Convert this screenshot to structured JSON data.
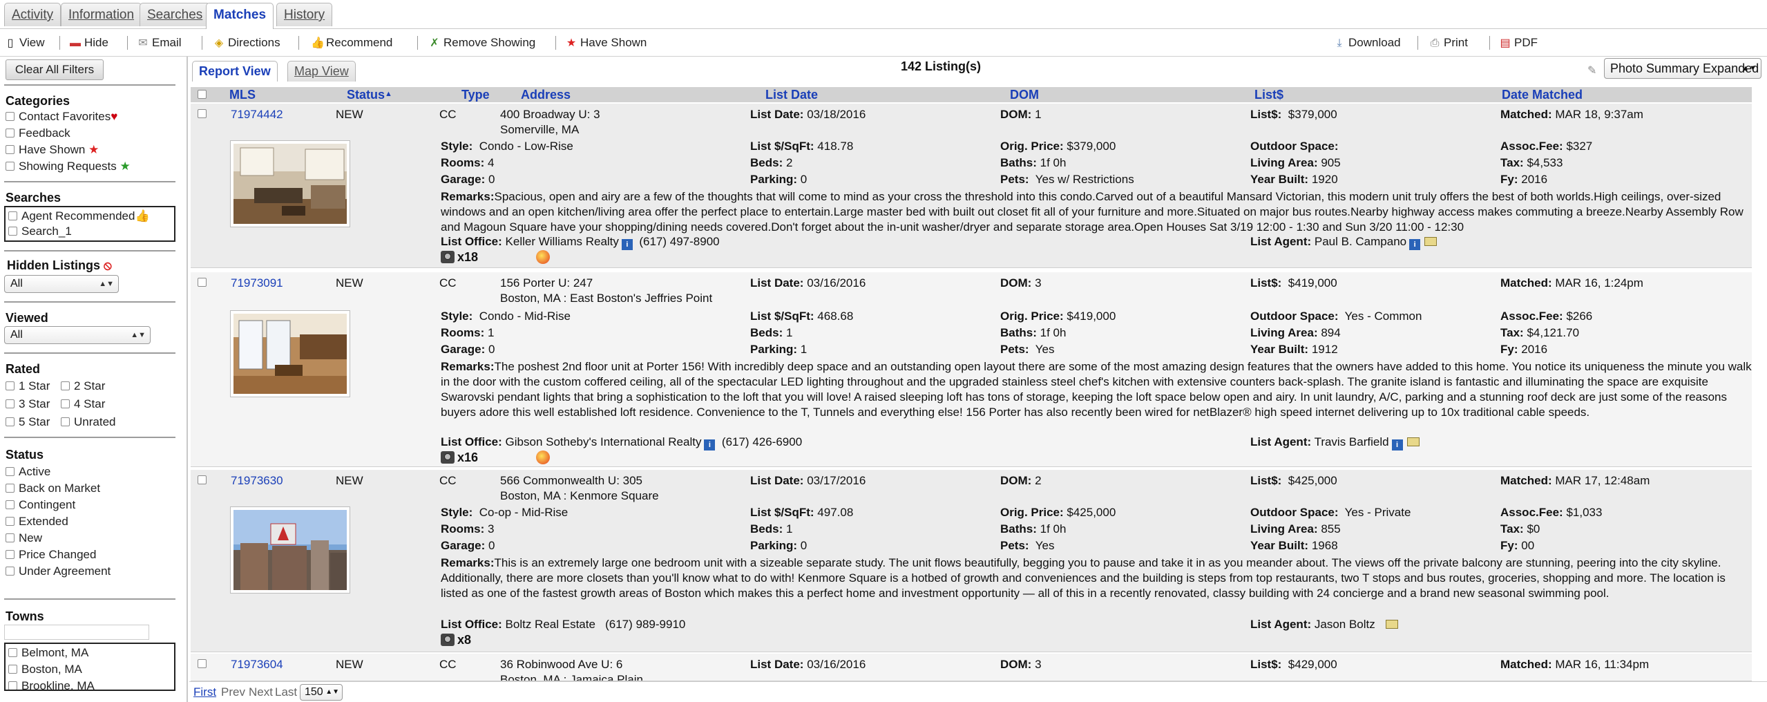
{
  "tabs": [
    "Activity",
    "Information",
    "Searches",
    "Matches",
    "History"
  ],
  "toolbar": {
    "view": "View",
    "hide": "Hide",
    "email": "Email",
    "directions": "Directions",
    "recommend": "Recommend",
    "remove_showing": "Remove Showing",
    "have_shown": "Have Shown",
    "download": "Download",
    "print": "Print",
    "pdf": "PDF"
  },
  "sidebar": {
    "clear_filters": "Clear All Filters",
    "categories_title": "Categories",
    "categories": [
      "Contact Favorites",
      "Feedback",
      "Have Shown",
      "Showing Requests"
    ],
    "searches_title": "Searches",
    "searches": [
      "Agent Recommended",
      "Search_1"
    ],
    "hidden_title": "Hidden Listings",
    "hidden_value": "All",
    "viewed_title": "Viewed",
    "viewed_value": "All",
    "rated_title": "Rated",
    "rated": [
      "1 Star",
      "2 Star",
      "3 Star",
      "4 Star",
      "5 Star",
      "Unrated"
    ],
    "status_title": "Status",
    "status": [
      "Active",
      "Back on Market",
      "Contingent",
      "Extended",
      "New",
      "Price Changed",
      "Under Agreement"
    ],
    "towns_title": "Towns",
    "towns_search": "",
    "towns": [
      "Belmont, MA",
      "Boston, MA",
      "Brookline, MA"
    ]
  },
  "main": {
    "view_tabs": [
      "Report View",
      "Map View"
    ],
    "count": "142 Listing(s)",
    "view_select": "Photo Summary Expanded",
    "columns": {
      "mls": "MLS",
      "status": "Status",
      "type": "Type",
      "address": "Address",
      "list_date": "List Date",
      "dom": "DOM",
      "list_price": "List$",
      "date_matched": "Date Matched"
    }
  },
  "labels": {
    "list_date": "List Date:",
    "dom": "DOM:",
    "list_price": "List$:",
    "matched": "Matched:",
    "style": "Style:",
    "list_sqft": "List $/SqFt:",
    "orig_price": "Orig. Price:",
    "outdoor": "Outdoor Space:",
    "assoc": "Assoc.Fee:",
    "rooms": "Rooms:",
    "beds": "Beds:",
    "baths": "Baths:",
    "living": "Living Area:",
    "tax": "Tax:",
    "garage": "Garage:",
    "parking": "Parking:",
    "pets": "Pets:",
    "year": "Year Built:",
    "fy": "Fy:",
    "remarks": "Remarks:",
    "office": "List Office:",
    "agent": "List Agent:"
  },
  "listings": [
    {
      "mls": "71974442",
      "status": "NEW",
      "type": "CC",
      "address1": "400 Broadway U: 3",
      "address2": "Somerville, MA",
      "list_date": "03/18/2016",
      "dom": "1",
      "list_price": "$379,000",
      "matched": "MAR 18, 9:37am",
      "style": "Condo - Low-Rise",
      "list_sqft": "418.78",
      "orig_price": "$379,000",
      "outdoor": "",
      "assoc": "$327",
      "rooms": "4",
      "beds": "2",
      "baths": "1f 0h",
      "living": "905",
      "tax": "$4,533",
      "garage": "0",
      "parking": "0",
      "pets": "Yes w/ Restrictions",
      "year": "1920",
      "fy": "2016",
      "remarks": "Spacious, open and airy are a few of the thoughts that will come to mind as your cross the threshold into this condo.Carved out of a beautiful Mansard Victorian, this modern unit truly offers the best of both worlds.High ceilings, over-sized windows and an open kitchen/living area offer the perfect place to entertain.Large master bed with built out closet fit all of your furniture and more.Situated on major bus routes.Nearby highway access makes commuting a breeze.Nearby Assembly Row and Magoun Square have your shopping/dining needs covered.Don't forget about the in-unit washer/dryer and separate storage area.Open Houses Sat 3/19 12:00 - 1:30 and Sun 3/20 11:00 - 12:30",
      "office": "Keller Williams Realty",
      "office_phone": "(617) 497-8900",
      "agent": "Paul B. Campano",
      "photos": "x18"
    },
    {
      "mls": "71973091",
      "status": "NEW",
      "type": "CC",
      "address1": "156 Porter U: 247",
      "address2": "Boston, MA : East Boston's Jeffries Point",
      "list_date": "03/16/2016",
      "dom": "3",
      "list_price": "$419,000",
      "matched": "MAR 16, 1:24pm",
      "style": "Condo - Mid-Rise",
      "list_sqft": "468.68",
      "orig_price": "$419,000",
      "outdoor": "Yes - Common",
      "assoc": "$266",
      "rooms": "1",
      "beds": "1",
      "baths": "1f 0h",
      "living": "894",
      "tax": "$4,121.70",
      "garage": "0",
      "parking": "1",
      "pets": "Yes",
      "year": "1912",
      "fy": "2016",
      "remarks": "The poshest 2nd floor unit at Porter 156! With incredibly deep space and an outstanding open layout there are some of the most amazing design features that the owners have added to this home. You notice its uniqueness the minute you walk in the door with the custom coffered ceiling, all of the spectacular LED lighting throughout and the upgraded stainless steel chef's kitchen with extensive counters back-splash. The granite island is fantastic and illuminating the space are exquisite Swarovski pendant lights that bring a sophistication to the loft that you will love! A raised sleeping loft has tons of storage, keeping the loft space below open and airy. In unit laundry, A/C, parking and a stunning roof deck are just some of the reasons buyers adore this well established loft residence. Convenience to the T, Tunnels and everything else! 156 Porter has also recently been wired for netBlazer® high speed internet delivering up to 10x traditional cable speeds.",
      "office": "Gibson Sotheby's International Realty",
      "office_phone": "(617) 426-6900",
      "agent": "Travis Barfield",
      "photos": "x16"
    },
    {
      "mls": "71973630",
      "status": "NEW",
      "type": "CC",
      "address1": "566 Commonwealth U: 305",
      "address2": "Boston, MA : Kenmore Square",
      "list_date": "03/17/2016",
      "dom": "2",
      "list_price": "$425,000",
      "matched": "MAR 17, 12:48am",
      "style": "Co-op - Mid-Rise",
      "list_sqft": "497.08",
      "orig_price": "$425,000",
      "outdoor": "Yes - Private",
      "assoc": "$1,033",
      "rooms": "3",
      "beds": "1",
      "baths": "1f 0h",
      "living": "855",
      "tax": "$0",
      "garage": "0",
      "parking": "0",
      "pets": "Yes",
      "year": "1968",
      "fy": "00",
      "remarks": "This is an extremely large one bedroom unit with a sizeable separate study. The unit flows beautifully, begging you to pause and take it in as you meander about. The views off the private balcony are stunning, peering into the city skyline. Additionally, there are more closets than you'll know what to do with! Kenmore Square is a hotbed of growth and conveniences and the building is steps from top restaurants, two T stops and bus routes, groceries, shopping and more. The location is listed as one of the fastest growth areas of Boston which makes this a perfect home and investment opportunity — all of this in a recently renovated, classy building with 24 concierge and a brand new seasonal swimming pool.",
      "office": "Boltz Real Estate",
      "office_phone": "(617) 989-9910",
      "agent": "Jason Boltz",
      "photos": "x8"
    },
    {
      "mls": "71973604",
      "status": "NEW",
      "type": "CC",
      "address1": "36 Robinwood Ave U: 6",
      "address2": "Boston, MA : Jamaica Plain",
      "list_date": "03/16/2016",
      "dom": "3",
      "list_price": "$429,000",
      "matched": "MAR 16, 11:34pm"
    }
  ],
  "pager": {
    "first": "First",
    "prev": "Prev",
    "next": "Next",
    "last": "Last",
    "size": "150"
  }
}
